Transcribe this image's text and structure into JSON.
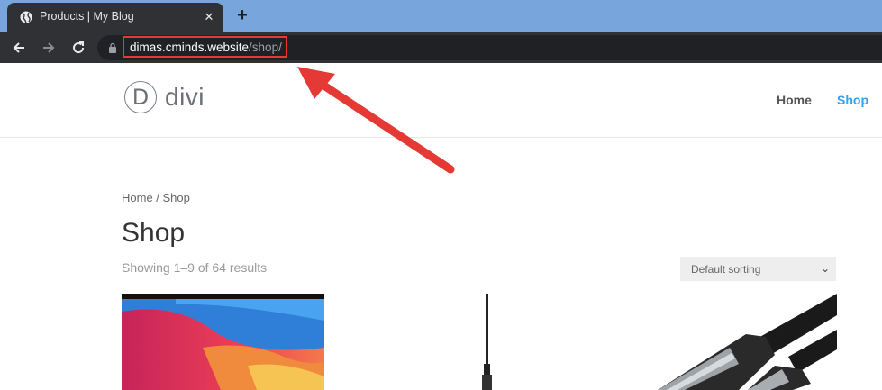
{
  "browser": {
    "tab_title": "Products | My Blog",
    "tab_close": "✕",
    "new_tab": "+",
    "url_host": "dimas.cminds.website",
    "url_path": "/shop/"
  },
  "site": {
    "logo_letter": "D",
    "logo_word": "divi",
    "nav": [
      {
        "label": "Home",
        "active": false
      },
      {
        "label": "Shop",
        "active": true
      }
    ],
    "accent_color": "#2ea3f2"
  },
  "page": {
    "breadcrumb": "Home / Shop",
    "title": "Shop",
    "result_count": "Showing 1–9 of 64 results",
    "sorting_selected": "Default sorting"
  },
  "annotation": {
    "highlight_color": "#e53935"
  }
}
